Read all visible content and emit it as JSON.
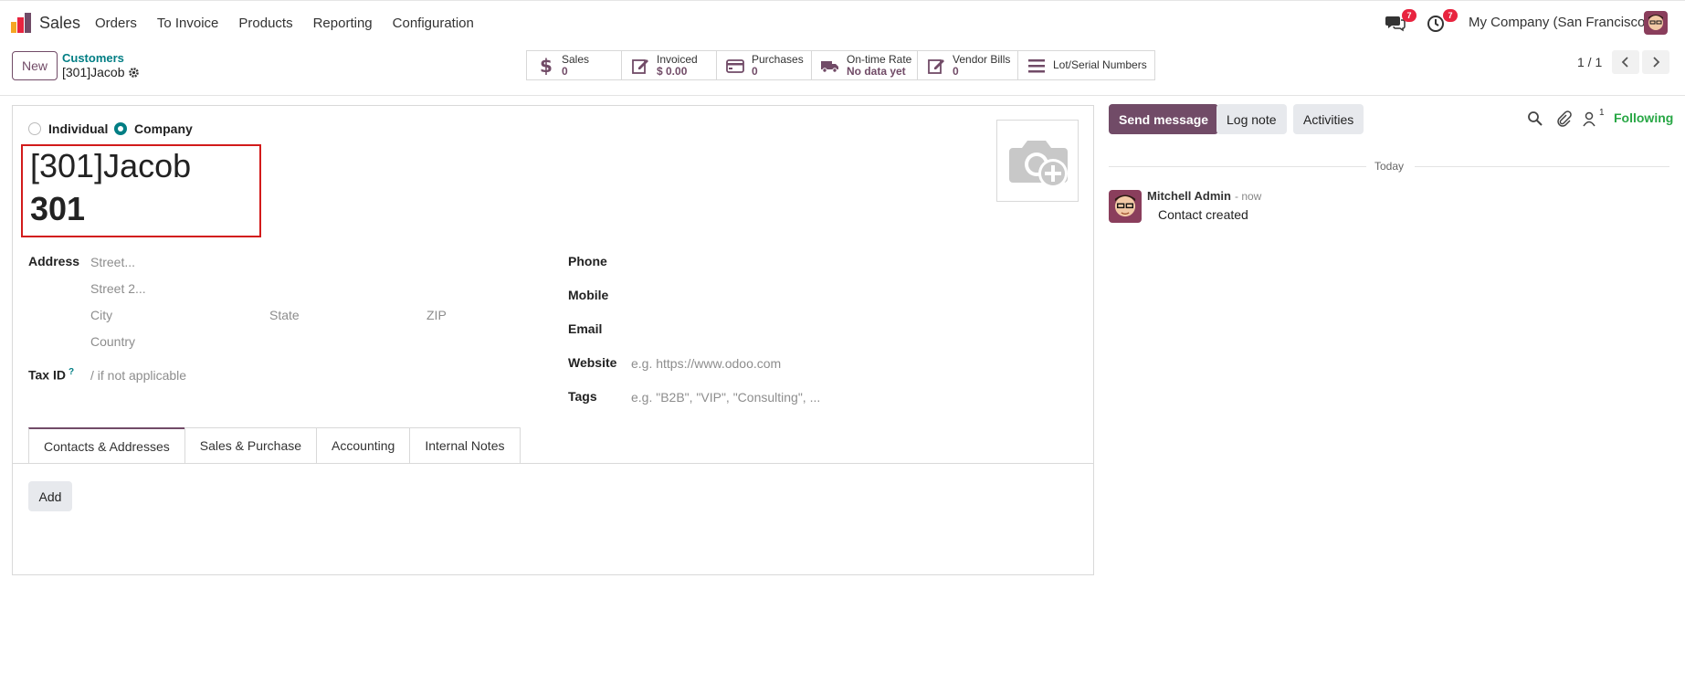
{
  "navbar": {
    "app_name": "Sales",
    "menu": [
      "Orders",
      "To Invoice",
      "Products",
      "Reporting",
      "Configuration"
    ],
    "messages_badge": "7",
    "activities_badge": "7",
    "company": "My Company (San Francisco)"
  },
  "control": {
    "new_label": "New",
    "breadcrumb_parent": "Customers",
    "breadcrumb_current": "[301]Jacob",
    "pager": "1 / 1"
  },
  "smart_buttons": [
    {
      "label": "Sales",
      "value": "0",
      "icon": "dollar-icon"
    },
    {
      "label": "Invoiced",
      "value": "$ 0.00",
      "icon": "edit-icon"
    },
    {
      "label": "Purchases",
      "value": "0",
      "icon": "credit-card-icon"
    },
    {
      "label": "On-time Rate",
      "value": "No data yet",
      "icon": "truck-icon"
    },
    {
      "label": "Vendor Bills",
      "value": "0",
      "icon": "edit-icon"
    },
    {
      "label": "Lot/Serial Numbers",
      "value": "",
      "icon": "list-icon"
    }
  ],
  "form": {
    "type_individual": "Individual",
    "type_company": "Company",
    "selected_type": "Company",
    "name": "[301]Jacob",
    "ref": "301",
    "address_label": "Address",
    "street_ph": "Street...",
    "street2_ph": "Street 2...",
    "city_ph": "City",
    "state_ph": "State",
    "zip_ph": "ZIP",
    "country_ph": "Country",
    "tax_label": "Tax ID",
    "tax_help": "?",
    "tax_ph": "/ if not applicable",
    "phone_label": "Phone",
    "mobile_label": "Mobile",
    "email_label": "Email",
    "website_label": "Website",
    "website_ph": "e.g. https://www.odoo.com",
    "tags_label": "Tags",
    "tags_ph": "e.g. \"B2B\", \"VIP\", \"Consulting\", ..."
  },
  "tabs": [
    "Contacts & Addresses",
    "Sales & Purchase",
    "Accounting",
    "Internal Notes"
  ],
  "add_label": "Add",
  "chatter": {
    "send_message": "Send message",
    "log_note": "Log note",
    "activities": "Activities",
    "followers_count": "1",
    "following": "Following",
    "date_separator": "Today",
    "message": {
      "author": "Mitchell Admin",
      "time": "- now",
      "body": "Contact created"
    }
  },
  "colors": {
    "brand": "#714b67",
    "teal": "#017e84",
    "highlight": "#d21b1b"
  }
}
